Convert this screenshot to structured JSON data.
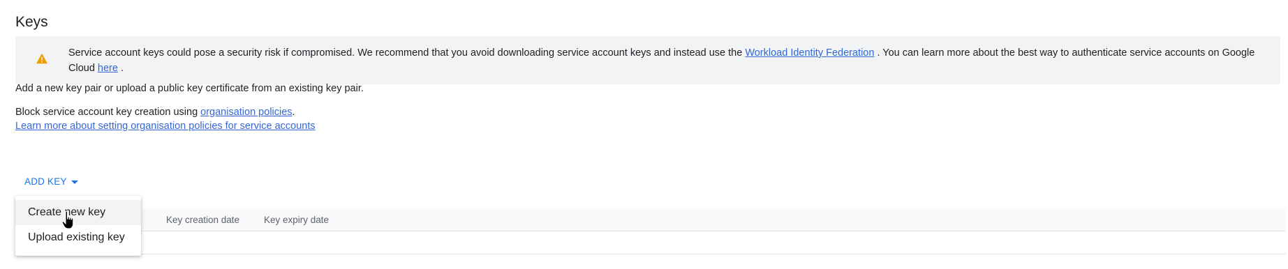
{
  "section": {
    "title": "Keys"
  },
  "warning": {
    "icon": "warning-icon",
    "icon_color": "#f29900",
    "text_before": "Service account keys could pose a security risk if compromised. We recommend that you avoid downloading service account keys and instead use the ",
    "link1": "Workload Identity Federation",
    "text_middle": " . You can learn more about the best way to authenticate service accounts on Google Cloud ",
    "link2": "here",
    "text_after": " ."
  },
  "intro": {
    "text": "Add a new key pair or upload a public key certificate from an existing key pair."
  },
  "policy": {
    "text_before": "Block service account key creation using ",
    "link": "organisation policies",
    "text_after": ".",
    "learn_more_link": "Learn more about setting organisation policies for service accounts"
  },
  "add_key": {
    "label": "ADD KEY",
    "icon": "caret-down-icon",
    "accent": "#1a73e8"
  },
  "table": {
    "columns": [
      "Key creation date",
      "Key expiry date"
    ]
  },
  "menu": {
    "items": [
      "Create new key",
      "Upload existing key"
    ]
  }
}
